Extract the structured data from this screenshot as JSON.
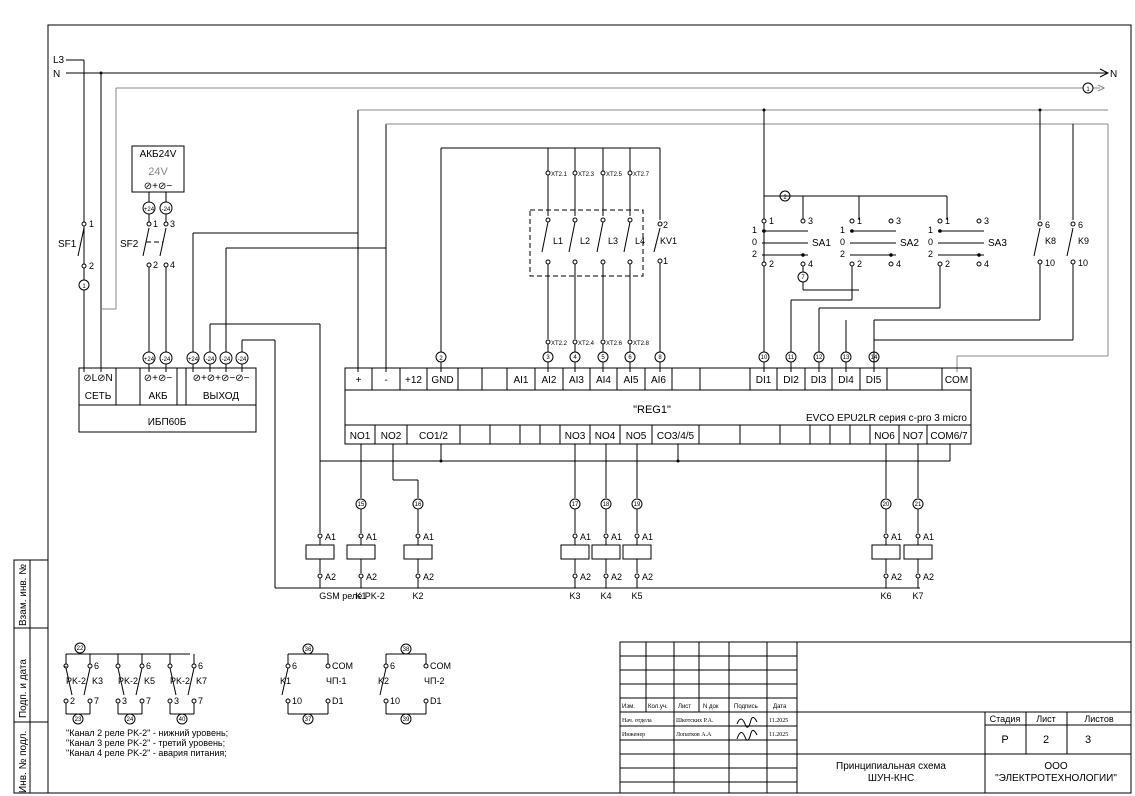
{
  "supply": {
    "l3": "L3",
    "n_left": "N",
    "n_right": "N",
    "bus_ref": "1"
  },
  "sf1": {
    "name": "SF1",
    "t1": "1",
    "t2": "2",
    "wire": "1"
  },
  "battery": {
    "name": "АКБ24V",
    "voltage": "24V",
    "pins": "⊘+⊘−"
  },
  "sf2": {
    "name": "SF2",
    "t1": "1",
    "t2": "2",
    "t3": "3",
    "t4": "4",
    "n24": "-24",
    "p24": "+24"
  },
  "psu": {
    "name": "ИБП60Б",
    "in_pins": "⊘L⊘N",
    "in_label": "СЕТЬ",
    "bat_pins": "⊘+⊘−",
    "bat_label": "АКБ",
    "out_pins": "⊘+⊘+⊘−⊘−",
    "out_label": "ВЫХОД",
    "t_p24": "+24",
    "t_m24": "-24"
  },
  "sensors": {
    "xt_top": [
      "XT2.1",
      "XT2.3",
      "XT2.5",
      "XT2.7"
    ],
    "xt_bot": [
      "XT2.2",
      "XT2.4",
      "XT2.6",
      "XT2.8"
    ],
    "names": [
      "L1",
      "L2",
      "L3",
      "L4"
    ],
    "kv": "KV1",
    "kv_t2": "2",
    "kv_t1": "1",
    "wires": [
      "3",
      "4",
      "5",
      "6",
      "8"
    ]
  },
  "switches": {
    "n2": "2",
    "sa1": "SA1",
    "sa2": "SA2",
    "sa3": "SA3",
    "t1": "1",
    "t3": "3",
    "t0": "0",
    "t2": "2",
    "t4": "4",
    "n7": "7",
    "k8": "K8",
    "k9": "K9",
    "t6": "6",
    "t10": "10",
    "di_wires": [
      "10",
      "11",
      "12",
      "13",
      "14"
    ]
  },
  "reg": {
    "name": "\"REG1\"",
    "model": "EVCO EPU2LR серия c-pro 3 micro",
    "top": [
      "+",
      "-",
      "+12",
      "GND",
      "",
      "",
      "AI1",
      "AI2",
      "AI3",
      "AI4",
      "AI5",
      "AI6",
      "",
      "",
      "DI1",
      "DI2",
      "DI3",
      "DI4",
      "DI5",
      "",
      "COM"
    ],
    "bottom": [
      "NO1",
      "NO2",
      "CO1/2",
      "",
      "",
      "",
      "",
      "NO3",
      "NO4",
      "NO5",
      "CO3/4/5",
      "",
      "",
      "",
      "",
      "",
      "",
      "NO6",
      "NO7",
      "COM6/7"
    ],
    "gnd_wire": "2"
  },
  "relays": {
    "coils": [
      {
        "label": "GSM реле PK-2",
        "wire": ""
      },
      {
        "label": "K1",
        "wire": "15"
      },
      {
        "label": "K2",
        "wire": "16"
      },
      {
        "label": "K3",
        "wire": "17"
      },
      {
        "label": "K4",
        "wire": "18"
      },
      {
        "label": "K5",
        "wire": "19"
      },
      {
        "label": "K6",
        "wire": "20"
      },
      {
        "label": "K7",
        "wire": "21"
      }
    ],
    "a1": "A1",
    "a2": "A2"
  },
  "pk_contacts": {
    "top_wire": "22",
    "groups": [
      {
        "relay": "PK-2",
        "k": "K3",
        "tl": "-",
        "tr": "6",
        "bl": "2",
        "br": "7",
        "bottom": "23"
      },
      {
        "relay": "PK-2",
        "k": "K5",
        "tl": "",
        "tr": "6",
        "bl": "3",
        "br": "7",
        "bottom": "24"
      },
      {
        "relay": "PK-2",
        "k": "K7",
        "tl": "",
        "tr": "6",
        "bl": "3",
        "br": "7",
        "bottom": "40"
      }
    ],
    "notes": [
      "\"Канал 2 реле PK-2\" - нижний уровень;",
      "\"Канал 3 реле PK-2\" - третий уровень;",
      "\"Канал 4 реле PK-2\" - авария питания;"
    ]
  },
  "freq_inputs": [
    {
      "top": "36",
      "k": "K1",
      "t6": "6",
      "com": "COM",
      "dev": "ЧП-1",
      "t10": "10",
      "d1": "D1",
      "bottom": "37"
    },
    {
      "top": "38",
      "k": "K2",
      "t6": "6",
      "com": "COM",
      "dev": "ЧП-2",
      "t10": "10",
      "d1": "D1",
      "bottom": "39"
    }
  ],
  "side_stamps": [
    "Взам. инв. №",
    "Подп. и дата",
    "Инв. № подл."
  ],
  "title_block": {
    "hdr": [
      "Изм.",
      "Кол.уч.",
      "Лист",
      "N док",
      "Подпись",
      "Дата"
    ],
    "role1": "Нач. отдела",
    "name1": "Шкотских Р.А.",
    "date1": "11.2025",
    "role2": "Инженер",
    "name2": "Лопатков А.А",
    "date2": "11.2025",
    "title1": "Принципиальная схема",
    "title2": "ШУН-КНС",
    "stage_h": "Стадия",
    "sheet_h": "Лист",
    "sheets_h": "Листов",
    "stage": "Р",
    "sheet": "2",
    "sheets": "3",
    "company1": "ООО",
    "company2": "\"ЭЛЕКТРОТЕХНОЛОГИИ\""
  }
}
